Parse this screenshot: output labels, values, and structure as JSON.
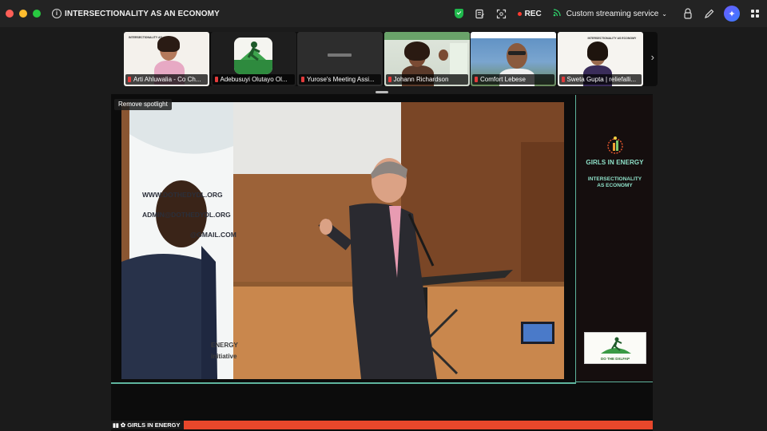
{
  "window": {
    "title": "INTERSECTIONALITY AS AN ECONOMY"
  },
  "toolbar": {
    "rec_label": "REC",
    "streaming_label": "Custom streaming service",
    "colors": {
      "accent": "#1fb84c",
      "rec": "#ff3b30"
    }
  },
  "participants": [
    {
      "name": "Arti Ahluwalia - Co Ch..."
    },
    {
      "name": "Adebusuyi Olutayo Ol..."
    },
    {
      "name": "Yurose's Meeting Assi..."
    },
    {
      "name": "Johann Richardson"
    },
    {
      "name": "Comfort Lebese"
    },
    {
      "name": "Sweta Gupta | reliefalli..."
    }
  ],
  "spotlight": {
    "button_label": "Remove spotlight"
  },
  "side_panel": {
    "brand": "GIRLS IN ENERGY",
    "subtitle_line1": "INTERSECTIONALITY",
    "subtitle_line2": "AS ECONOMY",
    "partner_logo_text": "DO THE DXLFAP"
  },
  "video_banner_text": [
    "WWW.DOTHEDYDL.ORG",
    "ADMIN@DOTHEDYDL.ORG",
    "@GMAIL.COM",
    "ENERGY",
    "initiative"
  ],
  "ticker": {
    "label": "GIRLS IN ENERGY"
  }
}
